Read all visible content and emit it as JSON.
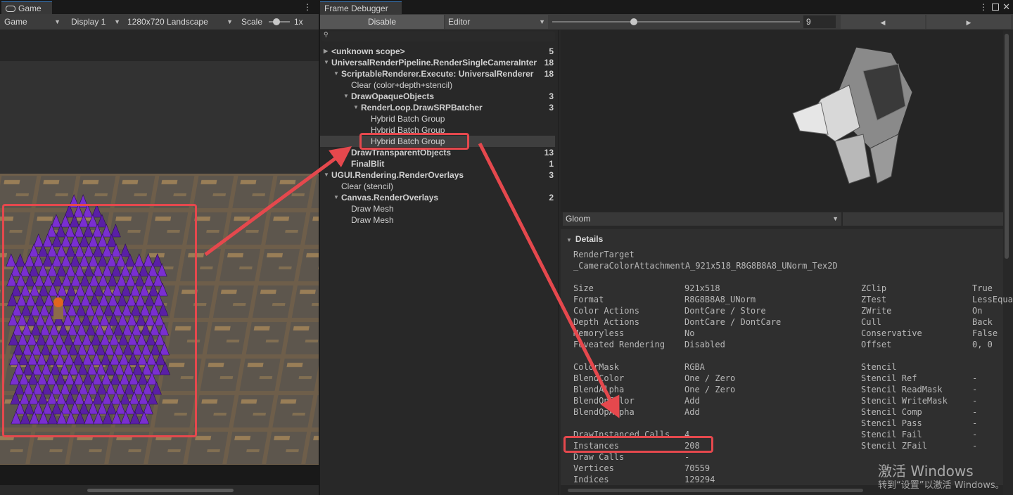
{
  "game": {
    "tab_title": "Game",
    "menu_icon": "kebab-menu-icon",
    "toolbar": {
      "view": "Game",
      "display": "Display 1",
      "resolution": "1280x720 Landscape",
      "scale_label": "Scale",
      "scale_value": "1x",
      "scale_level": 0.35
    }
  },
  "debugger": {
    "tab_title": "Frame Debugger",
    "disable_button": "Disable",
    "target": "Editor",
    "event_index": "9",
    "slider_level": 0.33,
    "prev_icon": "chevron-left-icon",
    "next_icon": "chevron-right-icon",
    "search_icon": "search-icon",
    "tree": [
      {
        "label": "<unknown scope>",
        "count": "5",
        "depth": 0,
        "arrow": "right",
        "bold": true
      },
      {
        "label": "UniversalRenderPipeline.RenderSingleCameraInter",
        "count": "18",
        "depth": 0,
        "arrow": "down",
        "bold": true
      },
      {
        "label": "ScriptableRenderer.Execute: UniversalRenderer",
        "count": "18",
        "depth": 1,
        "arrow": "down",
        "bold": true
      },
      {
        "label": "Clear (color+depth+stencil)",
        "count": "",
        "depth": 2,
        "arrow": "",
        "bold": false
      },
      {
        "label": "DrawOpaqueObjects",
        "count": "3",
        "depth": 2,
        "arrow": "down",
        "bold": true
      },
      {
        "label": "RenderLoop.DrawSRPBatcher",
        "count": "3",
        "depth": 3,
        "arrow": "down",
        "bold": true
      },
      {
        "label": "Hybrid Batch Group",
        "count": "",
        "depth": 4,
        "arrow": "",
        "bold": false
      },
      {
        "label": "Hybrid Batch Group",
        "count": "",
        "depth": 4,
        "arrow": "",
        "bold": false
      },
      {
        "label": "Hybrid Batch Group",
        "count": "",
        "depth": 4,
        "arrow": "",
        "bold": false,
        "selected": true
      },
      {
        "label": "DrawTransparentObjects",
        "count": "13",
        "depth": 2,
        "arrow": "right",
        "bold": true
      },
      {
        "label": "FinalBlit",
        "count": "1",
        "depth": 2,
        "arrow": "",
        "bold": true
      },
      {
        "label": "UGUI.Rendering.RenderOverlays",
        "count": "3",
        "depth": 0,
        "arrow": "down",
        "bold": true
      },
      {
        "label": "Clear (stencil)",
        "count": "",
        "depth": 1,
        "arrow": "",
        "bold": false
      },
      {
        "label": "Canvas.RenderOverlays",
        "count": "2",
        "depth": 1,
        "arrow": "down",
        "bold": true
      },
      {
        "label": "Draw Mesh",
        "count": "",
        "depth": 2,
        "arrow": "",
        "bold": false
      },
      {
        "label": "Draw Mesh",
        "count": "",
        "depth": 2,
        "arrow": "",
        "bold": false
      }
    ],
    "preview_mesh": "Gloom",
    "details": {
      "header": "Details",
      "render_target_label": "RenderTarget",
      "render_target_value": "_CameraColorAttachmentA_921x518_R8G8B8A8_UNorm_Tex2D",
      "left_rows": [
        {
          "k": "Size",
          "v": "921x518"
        },
        {
          "k": "Format",
          "v": "R8G8B8A8_UNorm"
        },
        {
          "k": "Color Actions",
          "v": "DontCare / Store"
        },
        {
          "k": "Depth Actions",
          "v": "DontCare / DontCare"
        },
        {
          "k": "Memoryless",
          "v": "No"
        },
        {
          "k": "Foveated Rendering",
          "v": "Disabled"
        },
        {
          "k": "",
          "v": ""
        },
        {
          "k": "ColorMask",
          "v": "RGBA"
        },
        {
          "k": "BlendColor",
          "v": "One / Zero"
        },
        {
          "k": "BlendAlpha",
          "v": "One / Zero"
        },
        {
          "k": "BlendOpColor",
          "v": "Add"
        },
        {
          "k": "BlendOpAlpha",
          "v": "Add"
        },
        {
          "k": "",
          "v": ""
        },
        {
          "k": "DrawInstanced Calls",
          "v": "4"
        },
        {
          "k": "Instances",
          "v": "208"
        },
        {
          "k": "Draw Calls",
          "v": "-"
        },
        {
          "k": "Vertices",
          "v": "70559"
        },
        {
          "k": "Indices",
          "v": "129294"
        }
      ],
      "right_rows": [
        {
          "k": "ZClip",
          "v": "True"
        },
        {
          "k": "ZTest",
          "v": "LessEqual"
        },
        {
          "k": "ZWrite",
          "v": "On"
        },
        {
          "k": "Cull",
          "v": "Back"
        },
        {
          "k": "Conservative",
          "v": "False"
        },
        {
          "k": "Offset",
          "v": "0, 0"
        },
        {
          "k": "",
          "v": ""
        },
        {
          "k": "Stencil",
          "v": ""
        },
        {
          "k": "Stencil Ref",
          "v": "-"
        },
        {
          "k": "Stencil ReadMask",
          "v": "-"
        },
        {
          "k": "Stencil WriteMask",
          "v": "-"
        },
        {
          "k": "Stencil Comp",
          "v": "-"
        },
        {
          "k": "Stencil Pass",
          "v": "-"
        },
        {
          "k": "Stencil Fail",
          "v": "-"
        },
        {
          "k": "Stencil ZFail",
          "v": "-"
        }
      ]
    }
  },
  "watermark": {
    "line1": "激活 Windows",
    "line2": "转到“设置”以激活 Windows。"
  },
  "colors": {
    "highlight": "#e5484d",
    "panel": "#282828",
    "toolbar": "#3c3c3c",
    "selection": "#3f3f3f"
  }
}
